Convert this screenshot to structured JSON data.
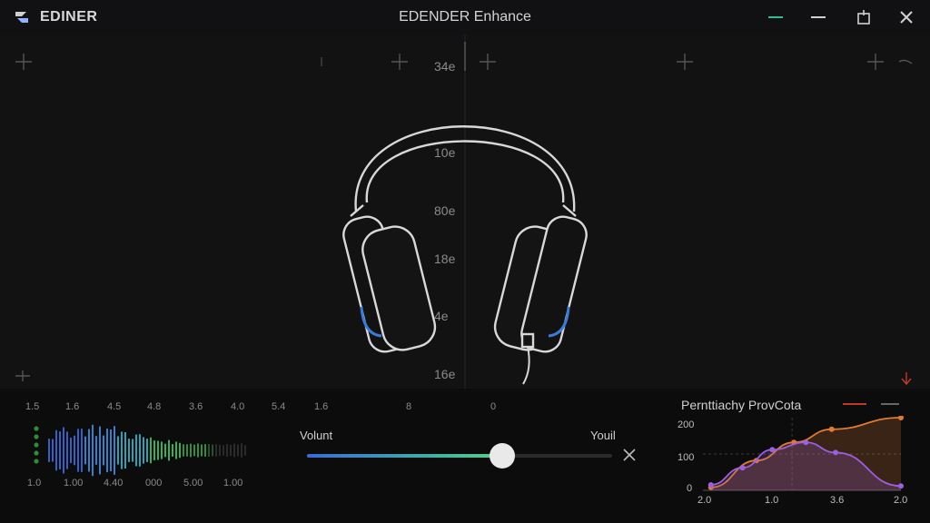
{
  "app": {
    "name": "EDINER",
    "window_title": "EDENDER Enhance"
  },
  "window_controls": {
    "accent": "#2fbf8f"
  },
  "center_scale": [
    "34e",
    "10e",
    "80e",
    "18e",
    "4e",
    "16e"
  ],
  "timeline": {
    "top_labels": [
      "1.5",
      "1.6",
      "4.5",
      "4.8",
      "3.6",
      "4.0",
      "5.4",
      "1.6",
      "8",
      "0"
    ],
    "bottom_labels": [
      "1.0",
      "1.00",
      "4.40",
      "000",
      "5.00",
      "1.00"
    ]
  },
  "volume": {
    "label": "Volunt",
    "right_label": "Youil",
    "level": 0.64
  },
  "colors": {
    "wave_left_start": "#8a4fc0",
    "wave_left_end": "#e0504a",
    "wave_right_start": "#2a8a6a",
    "wave_right_end": "#43d0c0",
    "series_purple": "#9b5fe0",
    "series_orange": "#e07a30"
  },
  "chart_data": {
    "type": "line",
    "title": "Pernttiachy ProvCota",
    "yticks": [
      "200",
      "100",
      "0"
    ],
    "xticks": [
      "2.0",
      "1.0",
      "3.6",
      "2.0"
    ],
    "ylim": [
      0,
      200
    ],
    "series": [
      {
        "color": "#9b5fe0",
        "points": [
          [
            0.04,
            15
          ],
          [
            0.2,
            62
          ],
          [
            0.35,
            112
          ],
          [
            0.52,
            132
          ],
          [
            0.67,
            104
          ],
          [
            1.0,
            12
          ]
        ]
      },
      {
        "color": "#e07a30",
        "points": [
          [
            0.04,
            8
          ],
          [
            0.27,
            82
          ],
          [
            0.46,
            132
          ],
          [
            0.65,
            168
          ],
          [
            1.0,
            200
          ]
        ]
      }
    ]
  }
}
